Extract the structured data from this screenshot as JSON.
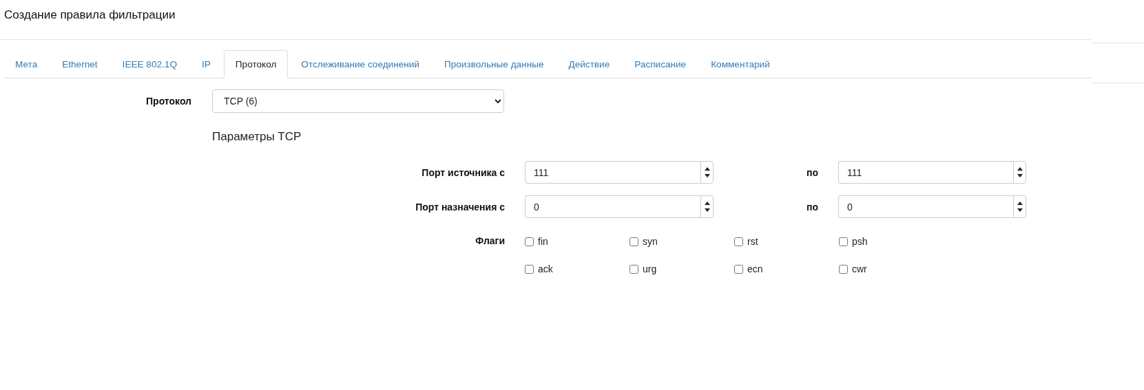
{
  "title": "Создание правила фильтрации",
  "tabs": [
    {
      "label": "Мета",
      "selected": false
    },
    {
      "label": "Ethernet",
      "selected": false
    },
    {
      "label": "IEEE 802.1Q",
      "selected": false
    },
    {
      "label": "IP",
      "selected": false
    },
    {
      "label": "Протокол",
      "selected": true
    },
    {
      "label": "Отслеживание соединений",
      "selected": false
    },
    {
      "label": "Произвольные данные",
      "selected": false
    },
    {
      "label": "Действие",
      "selected": false
    },
    {
      "label": "Расписание",
      "selected": false
    },
    {
      "label": "Комментарий",
      "selected": false
    }
  ],
  "protocol": {
    "label": "Протокол",
    "value": "TCP (6)"
  },
  "tcp": {
    "heading": "Параметры TCP",
    "ports": [
      {
        "label": "Порт источника с",
        "from": "111",
        "to_label": "по",
        "to": "111"
      },
      {
        "label": "Порт назначения с",
        "from": "0",
        "to_label": "по",
        "to": "0"
      }
    ],
    "flags": {
      "label": "Флаги",
      "items": [
        {
          "label": "fin",
          "checked": false
        },
        {
          "label": "syn",
          "checked": false
        },
        {
          "label": "rst",
          "checked": false
        },
        {
          "label": "psh",
          "checked": false
        },
        {
          "label": "ack",
          "checked": false
        },
        {
          "label": "urg",
          "checked": false
        },
        {
          "label": "ecn",
          "checked": false
        },
        {
          "label": "cwr",
          "checked": false
        }
      ]
    }
  }
}
